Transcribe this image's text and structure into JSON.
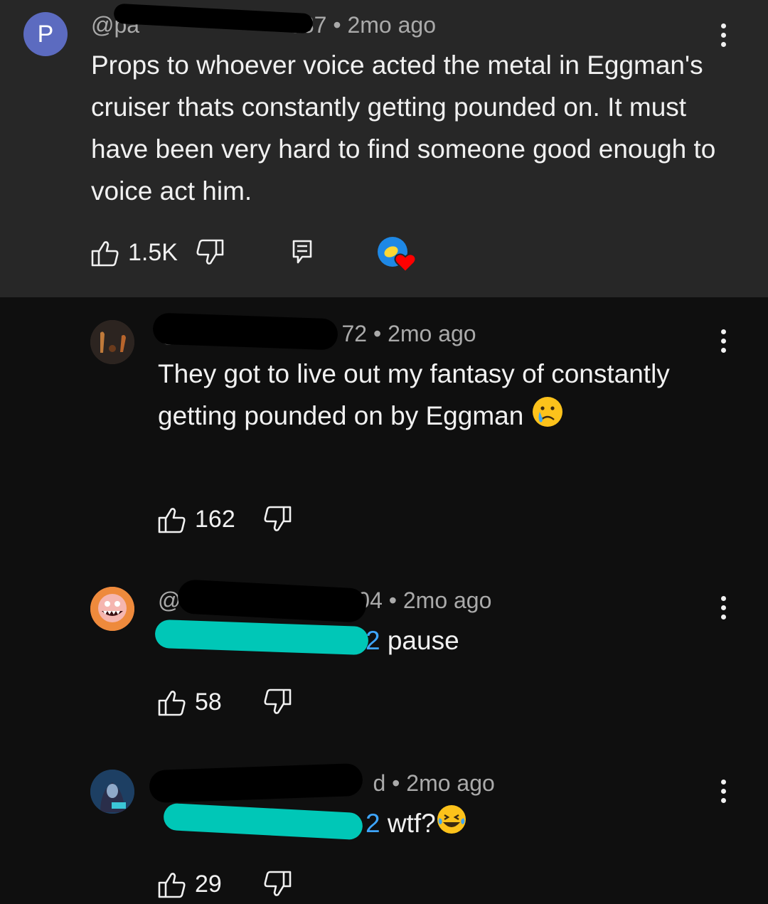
{
  "top_comment": {
    "avatar_letter": "P",
    "handle_visible": "@pa",
    "handle_suffix": "387",
    "age": "• 2mo ago",
    "text": "Props to whoever voice acted the metal in Eggman's cruiser thats constantly getting pounded on. It must have been very hard to find someone good enough to voice act him.",
    "like_count": "1.5K"
  },
  "replies": [
    {
      "handle_visible": "@",
      "handle_suffix": "72",
      "age": "• 2mo ago",
      "text": "They got to live out my fantasy of constantly getting pounded on by Eggman",
      "like_count": "162"
    },
    {
      "handle_visible": "@",
      "handle_suffix": "504",
      "age": "• 2mo ago",
      "mention_suffix": "2",
      "text": "pause",
      "like_count": "58"
    },
    {
      "handle_visible": "@",
      "handle_suffix": "d",
      "age": "• 2mo ago",
      "mention_suffix": "2",
      "text": "wtf?",
      "like_count": "29"
    }
  ],
  "colors": {
    "top_bg": "#272727",
    "page_bg": "#0f0f0f",
    "mention": "#3ea6ff",
    "heart": "#ff0000",
    "redaction_black": "#000000",
    "redaction_cyan": "#00c7b7"
  },
  "icons": [
    "like-icon",
    "dislike-icon",
    "reply-icon",
    "creator-heart-icon",
    "more-vert-icon",
    "crying-emoji-icon",
    "laughing-emoji-icon"
  ]
}
